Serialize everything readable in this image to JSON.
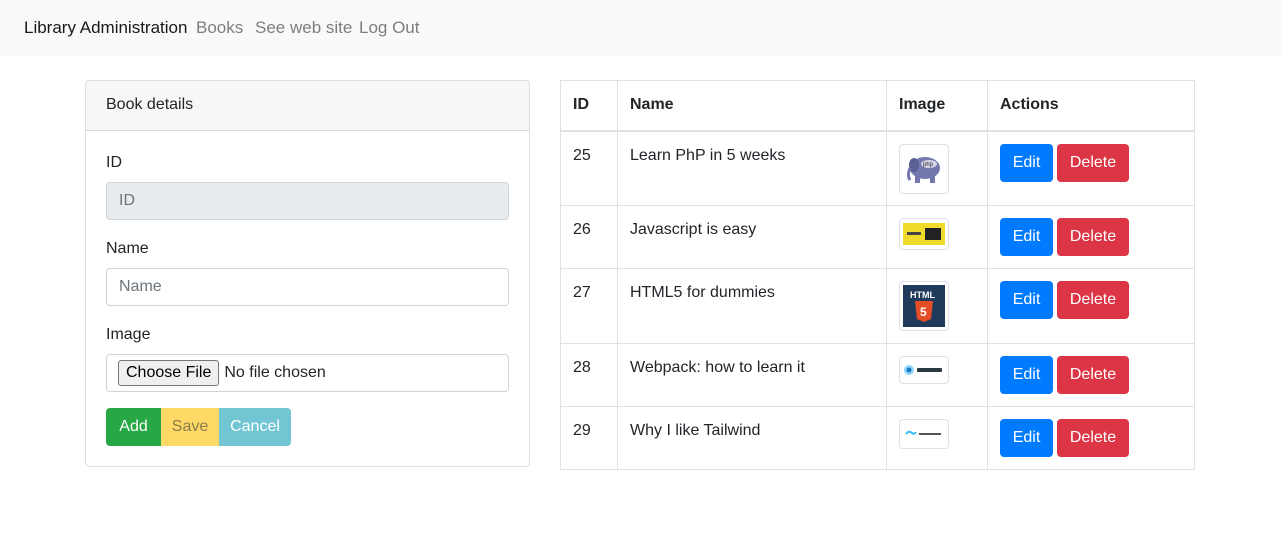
{
  "navbar": {
    "brand": "Library Administration",
    "links": [
      "Books",
      "See web site",
      "Log Out"
    ]
  },
  "form": {
    "header": "Book details",
    "id_label": "ID",
    "id_placeholder": "ID",
    "name_label": "Name",
    "name_placeholder": "Name",
    "image_label": "Image",
    "file_button": "Choose File",
    "file_status": "No file chosen",
    "add_label": "Add",
    "save_label": "Save",
    "cancel_label": "Cancel"
  },
  "table": {
    "headers": [
      "ID",
      "Name",
      "Image",
      "Actions"
    ],
    "edit_label": "Edit",
    "delete_label": "Delete",
    "rows": [
      {
        "id": "25",
        "name": "Learn PhP in 5 weeks",
        "image_icon": "php-elephant-icon"
      },
      {
        "id": "26",
        "name": "Javascript is easy",
        "image_icon": "javascript-banner-icon"
      },
      {
        "id": "27",
        "name": "HTML5 for dummies",
        "image_icon": "html5-logo-icon"
      },
      {
        "id": "28",
        "name": "Webpack: how to learn it",
        "image_icon": "webpack-logo-icon"
      },
      {
        "id": "29",
        "name": "Why I like Tailwind",
        "image_icon": "tailwindcss-logo-icon"
      }
    ]
  },
  "colors": {
    "add": "#28a745",
    "save": "#ffd966",
    "cancel": "#72c6d3",
    "edit": "#007bff",
    "delete": "#dc3545"
  }
}
